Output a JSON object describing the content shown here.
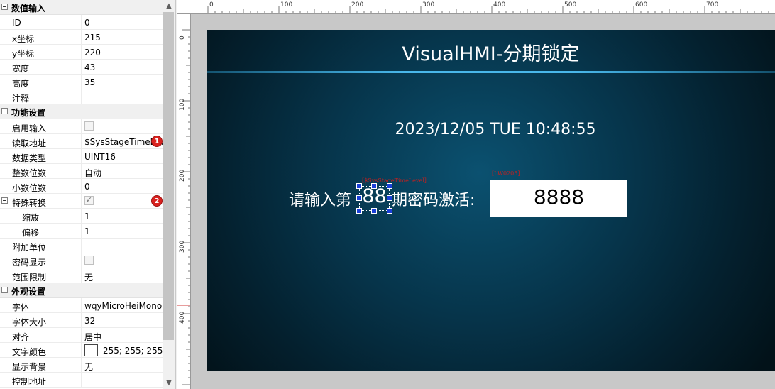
{
  "properties": {
    "sections": [
      {
        "title": "数值输入",
        "rows": [
          {
            "name": "ID",
            "value": "0"
          },
          {
            "name": "x坐标",
            "value": "215"
          },
          {
            "name": "y坐标",
            "value": "220"
          },
          {
            "name": "宽度",
            "value": "43"
          },
          {
            "name": "高度",
            "value": "35"
          },
          {
            "name": "注释",
            "value": ""
          }
        ]
      },
      {
        "title": "功能设置",
        "rows": [
          {
            "name": "启用输入",
            "value": "",
            "checkbox": false
          },
          {
            "name": "读取地址",
            "value": "$SysStageTimeLevel",
            "marker": "1"
          },
          {
            "name": "数据类型",
            "value": "UINT16"
          },
          {
            "name": "整数位数",
            "value": "自动"
          },
          {
            "name": "小数位数",
            "value": "0"
          },
          {
            "name": "特殊转换",
            "value": "",
            "checkbox": true,
            "marker": "2",
            "expandable": true
          },
          {
            "name": "缩放",
            "value": "1",
            "indent": true
          },
          {
            "name": "偏移",
            "value": "1",
            "indent": true
          },
          {
            "name": "附加单位",
            "value": ""
          },
          {
            "name": "密码显示",
            "value": "",
            "checkbox": false
          },
          {
            "name": "范围限制",
            "value": "无"
          }
        ]
      },
      {
        "title": "外观设置",
        "rows": [
          {
            "name": "字体",
            "value": "wqyMicroHeiMono"
          },
          {
            "name": "字体大小",
            "value": "32"
          },
          {
            "name": "对齐",
            "value": "居中"
          },
          {
            "name": "文字颜色",
            "value": "255; 255; 255",
            "swatch": "#ffffff"
          },
          {
            "name": "显示背景",
            "value": "无"
          },
          {
            "name": "控制地址",
            "value": ""
          }
        ]
      }
    ]
  },
  "ruler": {
    "h_labels": [
      "0",
      "100",
      "200",
      "300",
      "400",
      "500",
      "600",
      "700"
    ],
    "v_labels": [
      "0",
      "100",
      "200",
      "300",
      "400"
    ]
  },
  "hmi": {
    "title": "VisualHMI-分期锁定",
    "datetime": "2023/12/05 TUE 10:48:55",
    "prompt_left": "请输入第",
    "prompt_right": "期密码激活:",
    "stage_value": "88",
    "stage_tag": "[$SysStageTimeLevel]",
    "password_tag": "[LW0205]",
    "password_value": "8888",
    "background": "#06344a",
    "accent_line": "#49b7ea",
    "tag_color": "#c02020",
    "handle_color": "#1a3fd8"
  },
  "icons": {
    "collapse": "minus-box-icon",
    "scroll_up": "chevron-up-icon",
    "scroll_down": "chevron-down-icon",
    "marker": "numbered-badge-icon"
  }
}
